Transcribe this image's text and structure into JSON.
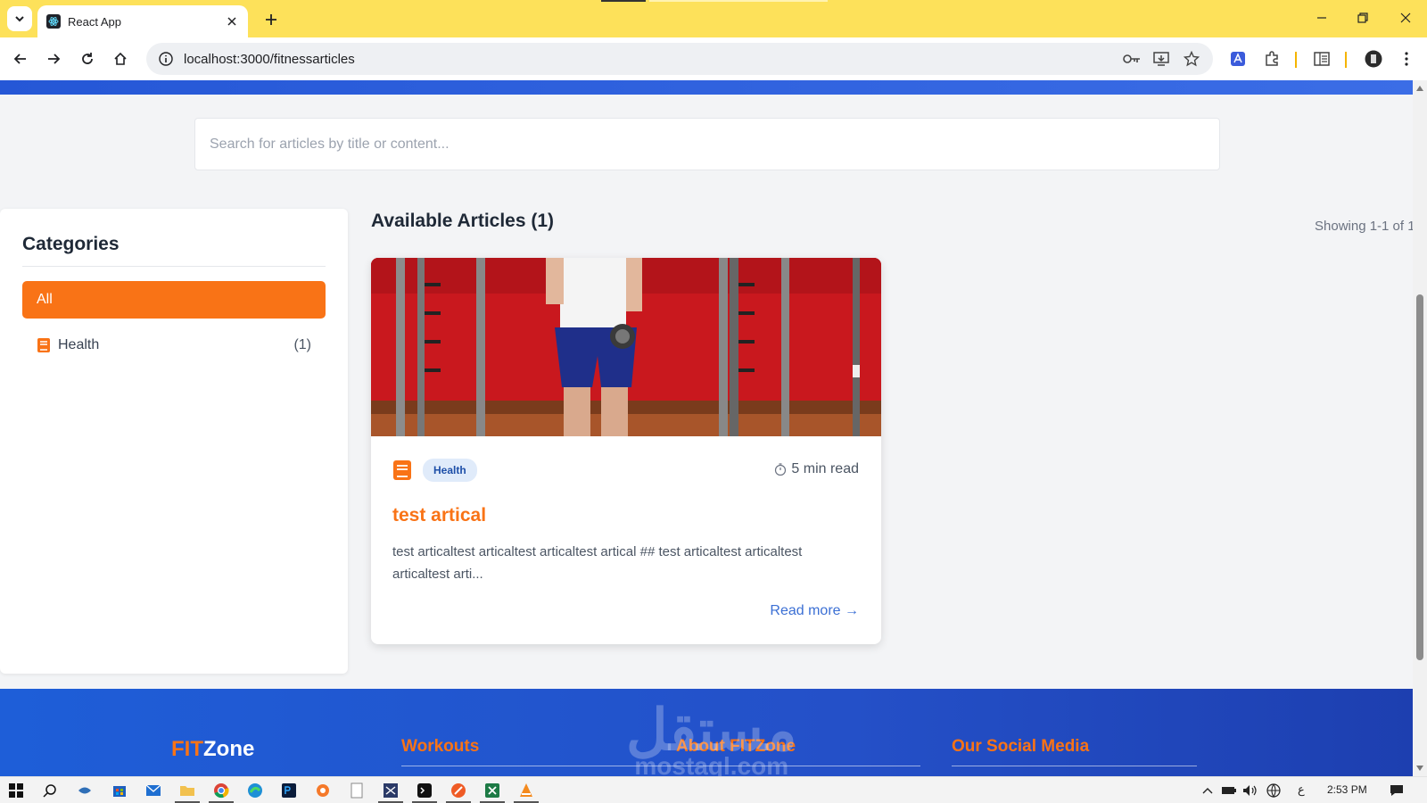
{
  "browser": {
    "tab_title": "React App",
    "url": "localhost:3000/fitnessarticles"
  },
  "search": {
    "placeholder": "Search for articles by title or content..."
  },
  "sidebar": {
    "title": "Categories",
    "all_label": "All",
    "items": [
      {
        "label": "Health",
        "count": "(1)",
        "icon": "book-icon"
      }
    ]
  },
  "main": {
    "title": "Available Articles (1)",
    "showing": "Showing 1-1 of 1",
    "articles": [
      {
        "category": "Health",
        "read_time": "5 min read",
        "title": "test artical",
        "excerpt": "test articaltest articaltest articaltest artical ## test articaltest articaltest articaltest arti...",
        "read_more": "Read more →"
      }
    ]
  },
  "footer": {
    "brand_fit": "FIT",
    "brand_zone": "Zone",
    "workouts": "Workouts",
    "about": "About FITZone",
    "social": "Our Social Media"
  },
  "watermark": {
    "arabic": "مستقل",
    "latin": "mostaql.com"
  },
  "taskbar": {
    "time": "2:53 PM",
    "lang": "ع"
  },
  "colors": {
    "accent": "#f97316",
    "brand_blue": "#2557d6",
    "tab_bar": "#fde15a"
  }
}
